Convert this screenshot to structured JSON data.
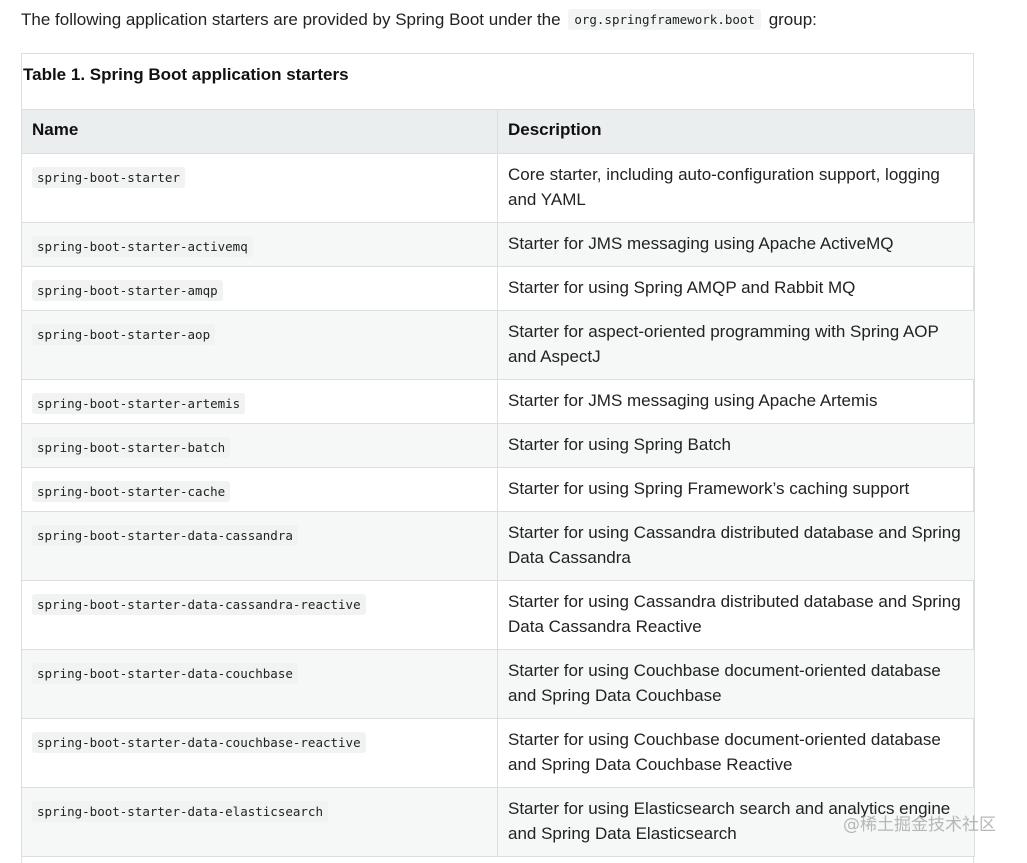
{
  "intro": {
    "text_before": "The following application starters are provided by Spring Boot under the",
    "group_code": "org.springframework.boot",
    "text_after": "group:"
  },
  "table": {
    "caption": "Table 1. Spring Boot application starters",
    "headers": [
      "Name",
      "Description"
    ],
    "rows": [
      {
        "name": "spring-boot-starter",
        "description": "Core starter, including auto-configuration support, logging and YAML"
      },
      {
        "name": "spring-boot-starter-activemq",
        "description": "Starter for JMS messaging using Apache ActiveMQ"
      },
      {
        "name": "spring-boot-starter-amqp",
        "description": "Starter for using Spring AMQP and Rabbit MQ"
      },
      {
        "name": "spring-boot-starter-aop",
        "description": "Starter for aspect-oriented programming with Spring AOP and AspectJ"
      },
      {
        "name": "spring-boot-starter-artemis",
        "description": "Starter for JMS messaging using Apache Artemis"
      },
      {
        "name": "spring-boot-starter-batch",
        "description": "Starter for using Spring Batch"
      },
      {
        "name": "spring-boot-starter-cache",
        "description": "Starter for using Spring Framework’s caching support"
      },
      {
        "name": "spring-boot-starter-data-cassandra",
        "description": "Starter for using Cassandra distributed database and Spring Data Cassandra"
      },
      {
        "name": "spring-boot-starter-data-cassandra-reactive",
        "description": "Starter for using Cassandra distributed database and Spring Data Cassandra Reactive"
      },
      {
        "name": "spring-boot-starter-data-couchbase",
        "description": "Starter for using Couchbase document-oriented database and Spring Data Couchbase"
      },
      {
        "name": "spring-boot-starter-data-couchbase-reactive",
        "description": "Starter for using Couchbase document-oriented database and Spring Data Couchbase Reactive"
      },
      {
        "name": "spring-boot-starter-data-elasticsearch",
        "description": "Starter for using Elasticsearch search and analytics engine and Spring Data Elasticsearch"
      }
    ]
  },
  "watermark": "@稀土掘金技术社区"
}
